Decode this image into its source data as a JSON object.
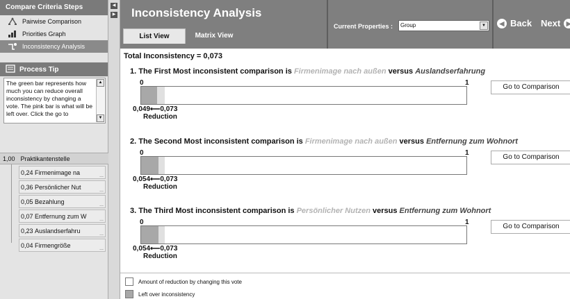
{
  "sidebar": {
    "steps_header": "Compare Criteria Steps",
    "steps": [
      {
        "label": "Pairwise Comparison",
        "icon": "scale-icon",
        "active": false
      },
      {
        "label": "Priorities Graph",
        "icon": "graph-icon",
        "active": false
      },
      {
        "label": "Inconsistency Analysis",
        "icon": "analysis-icon",
        "active": true
      }
    ],
    "tip_header": "Process Tip",
    "tip_text": "The green bar represents how much you can reduce overall inconsistency by changing a vote. The pink bar is what will be left over.  Click the go to",
    "tree_root": {
      "weight": "1,00",
      "label": "Praktikantenstelle"
    },
    "tree_items": [
      {
        "weight": "0,24",
        "label": "Firmenimage na"
      },
      {
        "weight": "0,36",
        "label": "Persönlicher Nut"
      },
      {
        "weight": "0,05",
        "label": "Bezahlung"
      },
      {
        "weight": "0,07",
        "label": "Entfernung zum W"
      },
      {
        "weight": "0,23",
        "label": "Auslandserfahru"
      },
      {
        "weight": "0,04",
        "label": "Firmengröße"
      }
    ]
  },
  "header": {
    "title": "Inconsistency Analysis",
    "tabs": {
      "list": "List View",
      "matrix": "Matrix View"
    },
    "current_properties_label": "Current Properties :",
    "current_properties_value": "Group",
    "back_label": "Back",
    "next_label": "Next"
  },
  "main": {
    "total_label": "Total Inconsistency = 0,073",
    "bar_min": "0",
    "bar_max": "1",
    "reduction_label": "Reduction",
    "go_button": "Go to Comparison",
    "comparisons": [
      {
        "prefix": "1. The First Most inconsistent comparison is ",
        "a": "Firmenimage nach außen",
        "versus": " versus ",
        "b": "Auslandserfahrung",
        "left_value": 0.049,
        "total_value": 0.073,
        "nums": "0,049⟵0,073"
      },
      {
        "prefix": "2. The Second Most inconsistent comparison is ",
        "a": "Firmenimage nach außen",
        "versus": " versus ",
        "b": "Entfernung zum Wohnort",
        "left_value": 0.054,
        "total_value": 0.073,
        "nums": "0,054⟵0,073"
      },
      {
        "prefix": "3. The Third Most inconsistent comparison is ",
        "a": "Persönlicher Nutzen",
        "versus": " versus ",
        "b": "Entfernung zum Wohnort",
        "left_value": 0.054,
        "total_value": 0.073,
        "nums": "0,054⟵0,073"
      }
    ]
  },
  "legend": {
    "reduction": "Amount of reduction by changing this vote",
    "leftover": "Left over inconsistency"
  }
}
